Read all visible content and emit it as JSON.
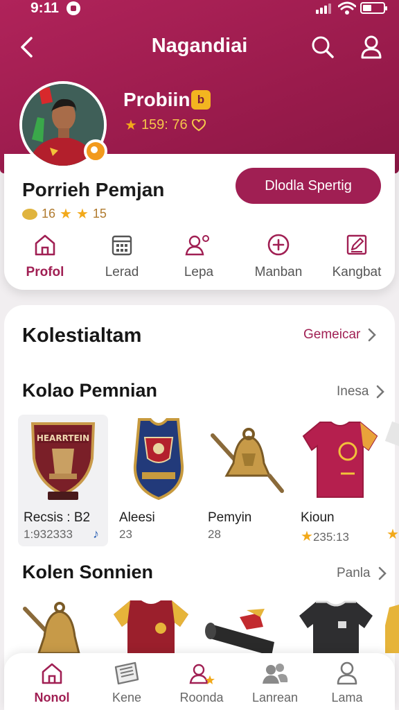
{
  "status": {
    "time": "9:11"
  },
  "app": {
    "title": "Nagandiai"
  },
  "profile": {
    "display_name": "Probiin",
    "chip": "b",
    "score": "159: 76",
    "player_name": "Porrieh Pemjan",
    "rating_a": "16",
    "rating_b": "15",
    "action_label": "Dlodla Spertig"
  },
  "quick_nav": [
    {
      "label": "Profol",
      "icon": "home-icon",
      "active": true
    },
    {
      "label": "Lerad",
      "icon": "calendar-icon",
      "active": false
    },
    {
      "label": "Lepa",
      "icon": "people-icon",
      "active": false
    },
    {
      "label": "Manban",
      "icon": "plus-circle-icon",
      "active": false
    },
    {
      "label": "Kangbat",
      "icon": "edit-icon",
      "active": false
    }
  ],
  "collection": {
    "title": "Kolestialtam",
    "link": "Gemeicar",
    "section1": {
      "title": "Kolao Pemnian",
      "link": "Inesa",
      "items": [
        {
          "name": "Recsis : B2",
          "value": "1:932333",
          "shield_text": "HEARRTEIN",
          "icon": "trophy-shield-icon"
        },
        {
          "name": "Aleesi",
          "value": "23",
          "icon": "jersey-icon"
        },
        {
          "name": "Pemyin",
          "value": "28",
          "icon": "bell-trophy-icon"
        },
        {
          "name": "Kioun",
          "value": "235:13",
          "icon": "shirt-icon"
        }
      ]
    },
    "section2": {
      "title": "Kolen Sonnien",
      "link": "Panla"
    }
  },
  "bottom_nav": [
    {
      "label": "Nonol",
      "icon": "home-icon",
      "active": true
    },
    {
      "label": "Kene",
      "icon": "news-icon",
      "active": false
    },
    {
      "label": "Roonda",
      "icon": "people-icon",
      "active": false
    },
    {
      "label": "Lanrean",
      "icon": "group-icon",
      "active": false
    },
    {
      "label": "Lama",
      "icon": "user-icon",
      "active": false
    }
  ],
  "colors": {
    "brand": "#a01f53",
    "accent": "#f2a91a"
  }
}
